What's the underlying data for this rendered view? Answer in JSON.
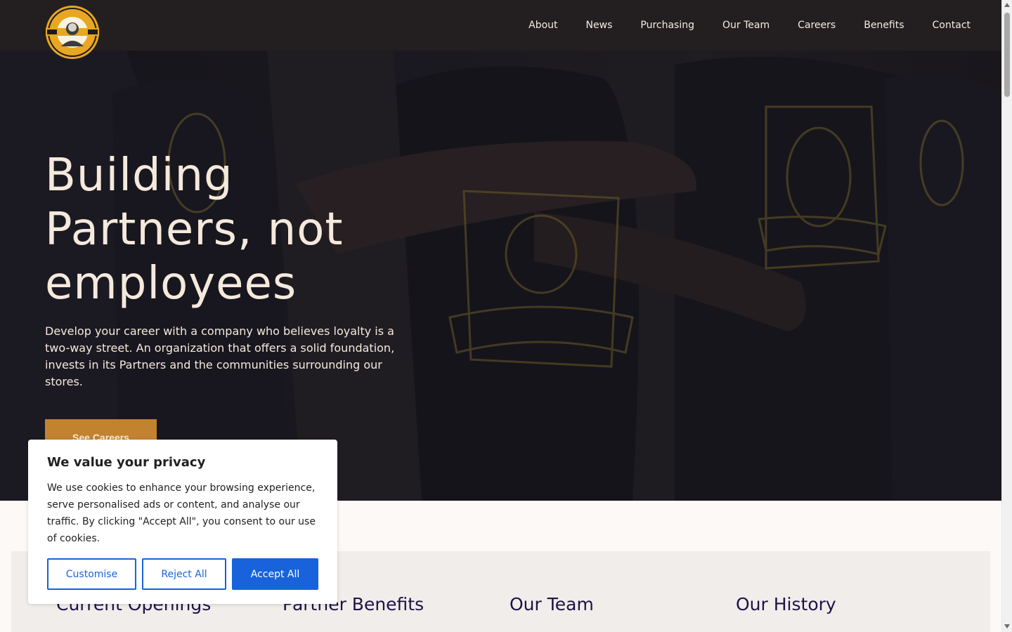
{
  "header": {
    "logo_icon": "ec-barton-logo-icon",
    "nav": [
      {
        "label": "About"
      },
      {
        "label": "News"
      },
      {
        "label": "Purchasing"
      },
      {
        "label": "Our Team"
      },
      {
        "label": "Careers"
      },
      {
        "label": "Benefits"
      },
      {
        "label": "Contact"
      }
    ]
  },
  "hero": {
    "title": "Building Partners, not employees",
    "description": "Develop your career with a company who believes loyalty is a two-way street. An organization that offers a solid foundation, invests in its Partners and the communities surrounding our stores.",
    "cta_label": "See Careers"
  },
  "sections": [
    {
      "title": "Current Openings"
    },
    {
      "title": "Partner Benefits"
    },
    {
      "title": "Our Team"
    },
    {
      "title": "Our History"
    }
  ],
  "cookie_banner": {
    "title": "We value your privacy",
    "text": "We use cookies to enhance your browsing experience, serve personalised ads or content, and analyse our traffic. By clicking \"Accept All\", you consent to our use of cookies.",
    "customise_label": "Customise",
    "reject_label": "Reject All",
    "accept_label": "Accept All"
  },
  "colors": {
    "header_bg": "#231f20",
    "accent": "#c38230",
    "cookie_primary": "#1863dc",
    "heading_navy": "#1d1347"
  }
}
